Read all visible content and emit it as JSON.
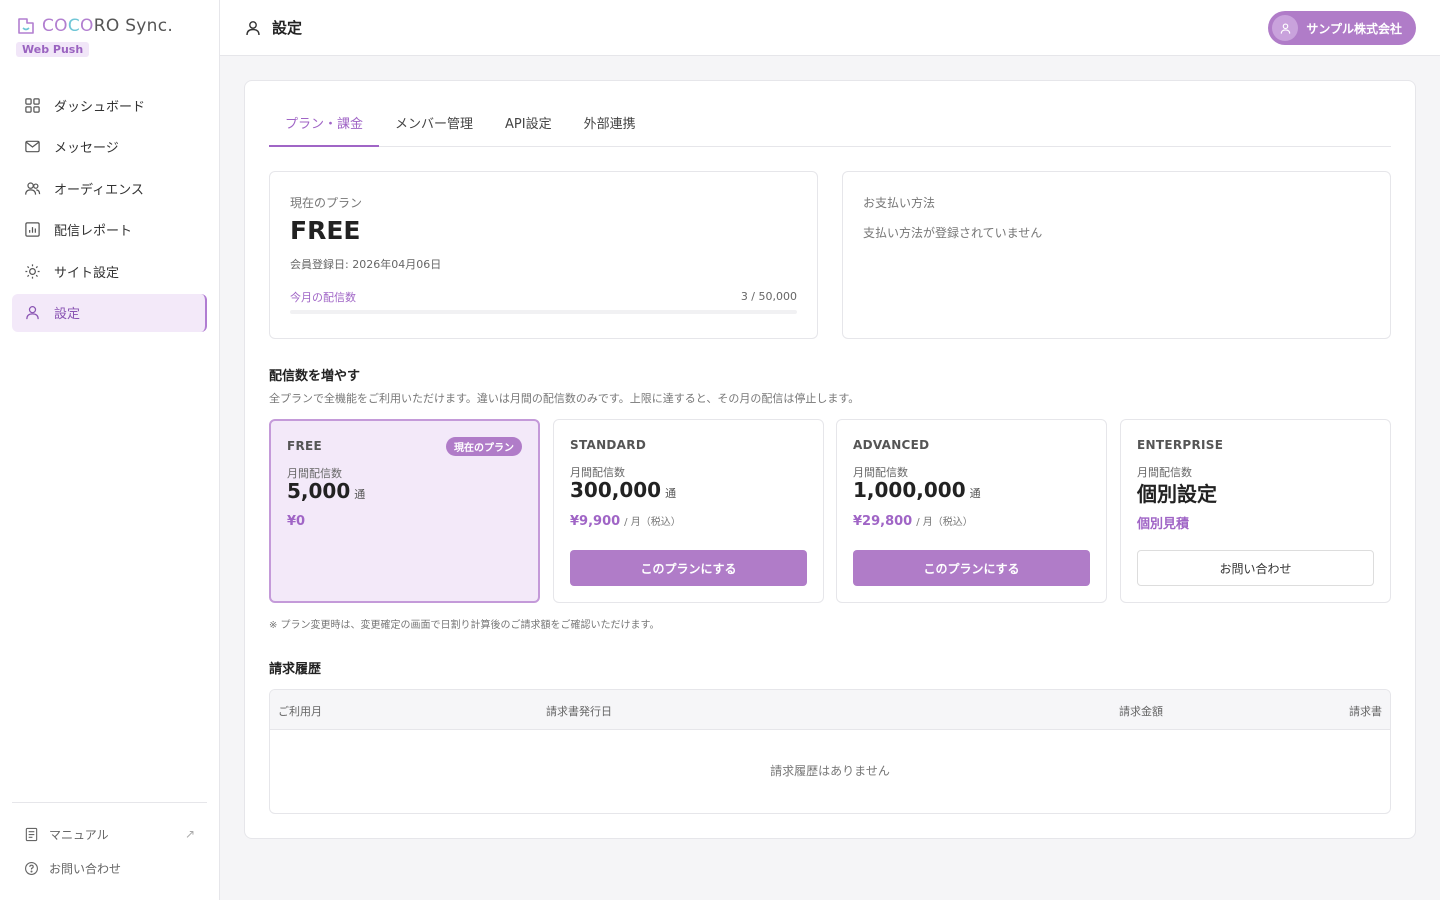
{
  "brand": {
    "logo": "COCORO Sync.",
    "logo_part1": "CO",
    "logo_part2": "C",
    "logo_part3": "O",
    "logo_part4": "RO Sync.",
    "badge": "Web Push"
  },
  "sidebar": {
    "items": [
      {
        "label": "ダッシュボード",
        "icon": "grid-icon"
      },
      {
        "label": "メッセージ",
        "icon": "mail-icon"
      },
      {
        "label": "オーディエンス",
        "icon": "users-icon"
      },
      {
        "label": "配信レポート",
        "icon": "chart-icon"
      },
      {
        "label": "サイト設定",
        "icon": "sun-gear-icon"
      },
      {
        "label": "設定",
        "icon": "person-icon",
        "active": true
      }
    ],
    "bottom": [
      {
        "label": "マニュアル",
        "icon": "document-icon",
        "external": true
      },
      {
        "label": "お問い合わせ",
        "icon": "help-icon"
      }
    ]
  },
  "header": {
    "title": "設定",
    "company": "サンプル株式会社"
  },
  "tabs": [
    {
      "label": "プラン・課金",
      "active": true
    },
    {
      "label": "メンバー管理"
    },
    {
      "label": "API設定"
    },
    {
      "label": "外部連携"
    }
  ],
  "current_plan": {
    "label": "現在のプラン",
    "name": "FREE",
    "registered": "会員登録日: 2026年04月06日",
    "send_label": "今月の配信数",
    "send_count": "3 / 50,000",
    "progress_fraction": 6e-05
  },
  "payment": {
    "label": "お支払い方法",
    "empty": "支払い方法が登録されていません"
  },
  "increase": {
    "title": "配信数を増やす",
    "desc": "全プランで全機能をご利用いただけます。違いは月間の配信数のみです。上限に達すると、その月の配信は停止します。"
  },
  "tiers": [
    {
      "name": "FREE",
      "badge": "現在のプラン",
      "qty_label": "月間配信数",
      "qty": "5,000",
      "unit": "通",
      "price": "¥0",
      "per": "",
      "button": ""
    },
    {
      "name": "STANDARD",
      "qty_label": "月間配信数",
      "qty": "300,000",
      "unit": "通",
      "price": "¥9,900",
      "per": "/ 月（税込）",
      "button": "このプランにする"
    },
    {
      "name": "ADVANCED",
      "qty_label": "月間配信数",
      "qty": "1,000,000",
      "unit": "通",
      "price": "¥29,800",
      "per": "/ 月（税込）",
      "button": "このプランにする"
    },
    {
      "name": "ENTERPRISE",
      "qty_label": "月間配信数",
      "qty": "個別設定",
      "unit": "",
      "price": "個別見積",
      "per": "",
      "button": "お問い合わせ"
    }
  ],
  "note": "※ プラン変更時は、変更確定の画面で日割り計算後のご請求額をご確認いただけます。",
  "history": {
    "title": "請求履歴",
    "columns": [
      "ご利用月",
      "請求書発行日",
      "請求金額",
      "請求書"
    ],
    "empty": "請求履歴はありません"
  },
  "colors": {
    "accent": "#b07cc8",
    "accent_text": "#a065c6",
    "active_bg": "#f3e9f9"
  }
}
